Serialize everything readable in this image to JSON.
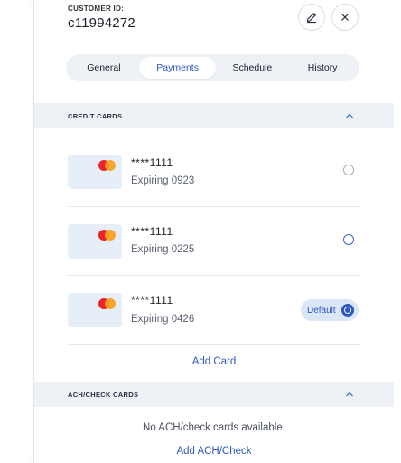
{
  "header": {
    "customer_label": "CUSTOMER ID:",
    "customer_id": "c11994272"
  },
  "icons": {
    "edit": "pencil-icon",
    "close": "close-icon",
    "collapse": "chevron-up-icon"
  },
  "tabs": [
    {
      "label": "General",
      "active": false
    },
    {
      "label": "Payments",
      "active": true
    },
    {
      "label": "Schedule",
      "active": false
    },
    {
      "label": "History",
      "active": false
    }
  ],
  "credit_cards": {
    "title": "CREDIT CARDS",
    "cards": [
      {
        "number": "****1111",
        "expiry": "Expiring 0923",
        "selected": false
      },
      {
        "number": "****1111",
        "expiry": "Expiring 0225",
        "selected": false
      },
      {
        "number": "****1111",
        "expiry": "Expiring 0426",
        "selected": true
      }
    ],
    "default_label": "Default",
    "add_label": "Add Card"
  },
  "ach": {
    "title": "ACH/CHECK CARDS",
    "empty_text": "No ACH/check cards available.",
    "add_label": "Add ACH/Check"
  },
  "colors": {
    "accent": "#2f56c4",
    "section_bg": "#eef1f6",
    "mastercard_red": "#e9242c",
    "mastercard_yellow": "#f8a01c"
  }
}
